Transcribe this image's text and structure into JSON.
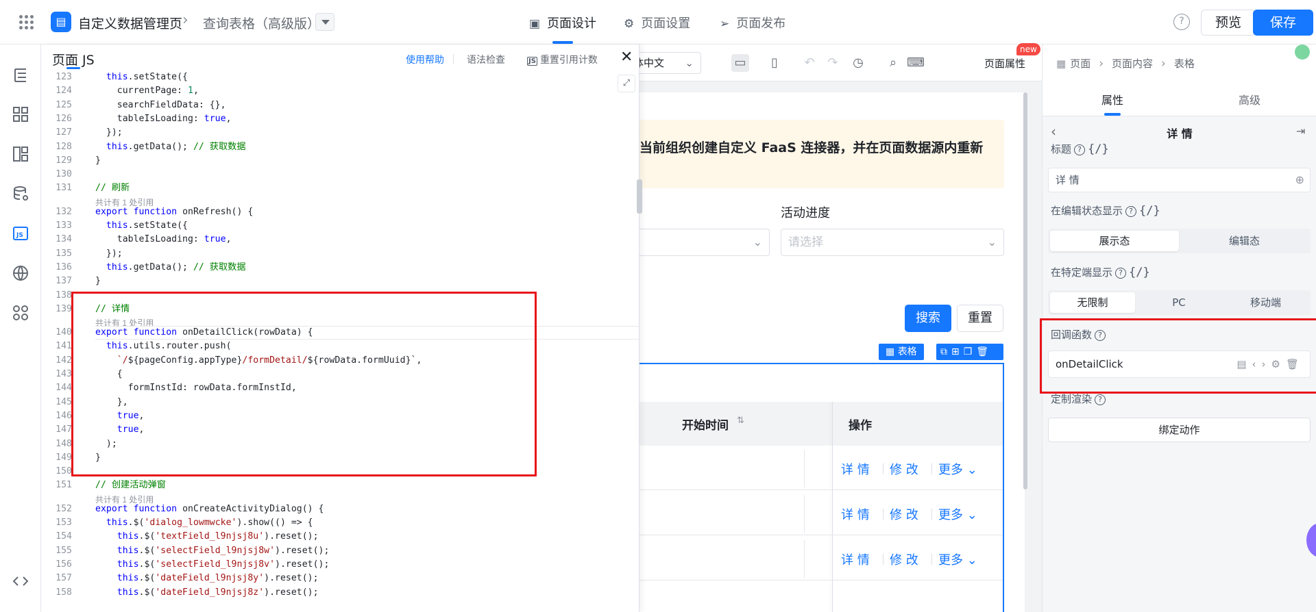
{
  "topbar": {
    "app_name": "自定义数据管理页",
    "page_name": "查询表格（高级版）",
    "tabs": [
      {
        "label": "页面设计",
        "icon": "layout-icon"
      },
      {
        "label": "页面设置",
        "icon": "gear-icon"
      },
      {
        "label": "页面发布",
        "icon": "send-icon"
      }
    ],
    "preview_label": "预览",
    "save_label": "保存",
    "help_glyph": "?"
  },
  "code_panel": {
    "title": "页面 JS",
    "help_link": "使用帮助",
    "lint_link": "语法检查",
    "reset_refs_link": "重置引用计数",
    "ref_hint": "共计有 1 处引用",
    "lines": [
      {
        "n": "123",
        "text": "  this.setState({"
      },
      {
        "n": "124",
        "text": "    currentPage: 1,"
      },
      {
        "n": "125",
        "text": "    searchFieldData: {},"
      },
      {
        "n": "126",
        "text": "    tableIsLoading: true,"
      },
      {
        "n": "127",
        "text": "  });"
      },
      {
        "n": "128",
        "text": "  this.getData(); // 获取数据"
      },
      {
        "n": "129",
        "text": "}"
      },
      {
        "n": "130",
        "text": ""
      },
      {
        "n": "131",
        "text": "// 刷新"
      },
      {
        "n": "132",
        "text": "export function onRefresh() {"
      },
      {
        "n": "133",
        "text": "  this.setState({"
      },
      {
        "n": "134",
        "text": "    tableIsLoading: true,"
      },
      {
        "n": "135",
        "text": "  });"
      },
      {
        "n": "136",
        "text": "  this.getData(); // 获取数据"
      },
      {
        "n": "137",
        "text": "}"
      },
      {
        "n": "138",
        "text": ""
      },
      {
        "n": "139",
        "text": "// 详情"
      },
      {
        "n": "140",
        "text": "export function onDetailClick(rowData) {"
      },
      {
        "n": "141",
        "text": "  this.utils.router.push("
      },
      {
        "n": "142",
        "text": "    `/${pageConfig.appType}/formDetail/${rowData.formUuid}`,"
      },
      {
        "n": "143",
        "text": "    {"
      },
      {
        "n": "144",
        "text": "      formInstId: rowData.formInstId,"
      },
      {
        "n": "145",
        "text": "    },"
      },
      {
        "n": "146",
        "text": "    true,"
      },
      {
        "n": "147",
        "text": "    true,"
      },
      {
        "n": "148",
        "text": "  );"
      },
      {
        "n": "149",
        "text": "}"
      },
      {
        "n": "150",
        "text": ""
      },
      {
        "n": "151",
        "text": "// 创建活动弹窗"
      },
      {
        "n": "152",
        "text": "export function onCreateActivityDialog() {"
      },
      {
        "n": "153",
        "text": "  this.$('dialog_lowmwcke').show(() => {"
      },
      {
        "n": "154",
        "text": "    this.$('textField_l9njsj8u').reset();"
      },
      {
        "n": "155",
        "text": "    this.$('selectField_l9njsj8w').reset();"
      },
      {
        "n": "156",
        "text": "    this.$('selectField_l9njsj8v').reset();"
      },
      {
        "n": "157",
        "text": "    this.$('dateField_l9njsj8y').reset();"
      },
      {
        "n": "158",
        "text": "    this.$('dateField_l9njsj8z').reset();"
      }
    ]
  },
  "canvas": {
    "lang_value": "体中文",
    "page_props_label": "页面属性",
    "new_badge": "new",
    "notice_text": "当前组织创建自定义 FaaS 连接器，并在页面数据源内重新",
    "progress_label": "活动进度",
    "select_placeholder": "请选择",
    "search_label": "搜索",
    "reset_label": "重置",
    "table_tag": "表格",
    "col_start": "开始时间",
    "col_op": "操作",
    "row_actions": [
      {
        "detail": "详 情",
        "edit": "修 改",
        "more": "更多"
      },
      {
        "detail": "详 情",
        "edit": "修 改",
        "more": "更多"
      },
      {
        "detail": "详 情",
        "edit": "修 改",
        "more": "更多"
      }
    ]
  },
  "right_panel": {
    "breadcrumb": [
      "页面",
      "页面内容",
      "表格"
    ],
    "tabs": [
      "属性",
      "高级"
    ],
    "section_title": "详 情",
    "title_label": "标题",
    "title_value": "详 情",
    "edit_show_label": "在编辑状态显示",
    "edit_modes": [
      "展示态",
      "编辑态"
    ],
    "device_label": "在特定端显示",
    "device_options": [
      "无限制",
      "PC",
      "移动端"
    ],
    "callback_label": "回调函数",
    "callback_value": "onDetailClick",
    "custom_render_label": "定制渲染",
    "bind_action_label": "绑定动作",
    "bind_glyph": "{/}"
  }
}
